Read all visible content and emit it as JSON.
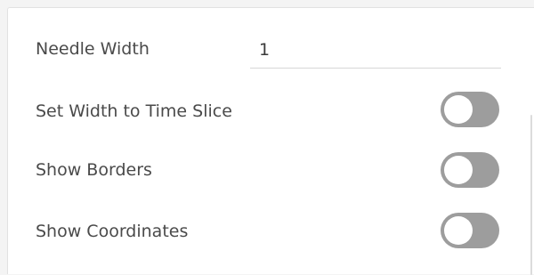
{
  "settings": {
    "needle_width": {
      "label": "Needle Width",
      "value": "1"
    },
    "set_width_to_time_slice": {
      "label": "Set Width to Time Slice",
      "enabled": false
    },
    "show_borders": {
      "label": "Show Borders",
      "enabled": false
    },
    "show_coordinates": {
      "label": "Show Coordinates",
      "enabled": false
    }
  },
  "colors": {
    "toggle_off": "#9d9d9d",
    "knob": "#ffffff",
    "label_text": "#4a4a4a"
  }
}
